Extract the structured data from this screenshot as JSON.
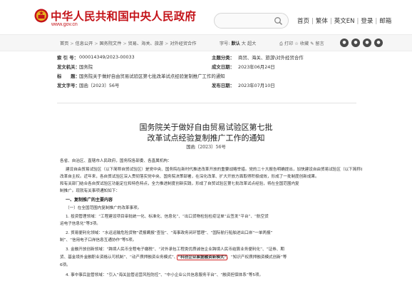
{
  "header": {
    "site_title": "中华人民共和国中央人民政府",
    "site_url": "www.gov.cn",
    "nav": [
      "首页",
      "繁体",
      "英文EN",
      "登录",
      "邮箱"
    ]
  },
  "breadcrumb": {
    "items": [
      "首页",
      "信息公开",
      "国务院文件",
      "贸易、海关、旅游",
      "对外经贸合作"
    ],
    "font_label": "字号:",
    "font_size_options": [
      "默认",
      "大",
      "超大"
    ],
    "utilities": [
      "打印",
      "收藏",
      "留言"
    ]
  },
  "info": {
    "rows": [
      {
        "k": "索 引 号：",
        "v": "000014349/2023-00033",
        "k2": "主题分类：",
        "v2": "商贸、海关、旅游\\对外经贸合作"
      },
      {
        "k": "发文机关：",
        "v": "国务院",
        "k2": "成文日期：",
        "v2": "2023年06月24日"
      },
      {
        "k": "标　　题：",
        "v": "国务院关于做好自由贸易试验区第七批改革试点经验复制推广工作的通知",
        "k2": "",
        "v2": ""
      },
      {
        "k": "发文字号：",
        "v": "国函〔2023〕56号",
        "k2": "发布日期：",
        "v2": "2023年07月10日"
      }
    ]
  },
  "document": {
    "title_line1": "国务院关于做好自由贸易试验区第七批",
    "title_line2": "改革试点经验复制推广工作的通知",
    "doc_number": "国函〔2023〕56号",
    "salutation": "各省、自治区、直辖市人民政府，国务院各部委、各直属机构：",
    "para1_l1": "建设自由贸易试验区（以下简称自贸试验区）是党中央、国务院在新时代推进改革开放的重要战略举措。党的二十大报告明确提出，加快建设自由贸易试验区（以下简称自贸试验区），赋予更大",
    "para1_l2": "改革自主权。近年来，各自贸试验区深入贯彻落实党中央、国务院决策部署，在深化改革、扩大开放方面取得积极成效，形成了一批制度创新成果。",
    "para1_l3": "和有关部门结合各自贸试验区功能定位和特色特点，全力推进制度创新实践，形成了自贸试验区第七批改革试点经验，将在全国范围内复",
    "para1_l4": "制推广。现就有关事项通知如下：",
    "heading1": "一、复制推广的主要内容",
    "heading1a": "（一）在全国范围内复制推广的改革事项。",
    "item1": "1. 投资管理领域：“工程建设项目审批统一化、标准化、信息化”、“出口货物检验检疫证单“云签发”平台”、“航空货",
    "item1b": "运电子信息化”等3项。",
    "item2": "2. 贸易便利化领域：“水运运输危险货物“谎报瞒报”查验”、“海事政务闭环管理”、“国际航行船舶进出口岸“一单两报”",
    "item2b": "制”、“信用电子口岸信息互通协作”等5项。",
    "item3_pre": "3. 金融开放创新领域：“跨境人民币全程电子缴税”、“对外承包工程类优质诚信企业跨境人民币结算业务便利化”、“证券、期",
    "item3b_pre": "货、基金境外金融职业资格认可机制”、“动产质押融资业务模式”、",
    "item3b_hl": "“科创企业票据融资新模式”",
    "item3b_post": "、“知识产权质押融资模式创新”等",
    "item3c": "6项。",
    "item4": "4. 事中事后监管领域：“引入“海关监管运营风险防控”、“中小企业公共信息服务平台”、“融资担保体系”等5项。"
  }
}
